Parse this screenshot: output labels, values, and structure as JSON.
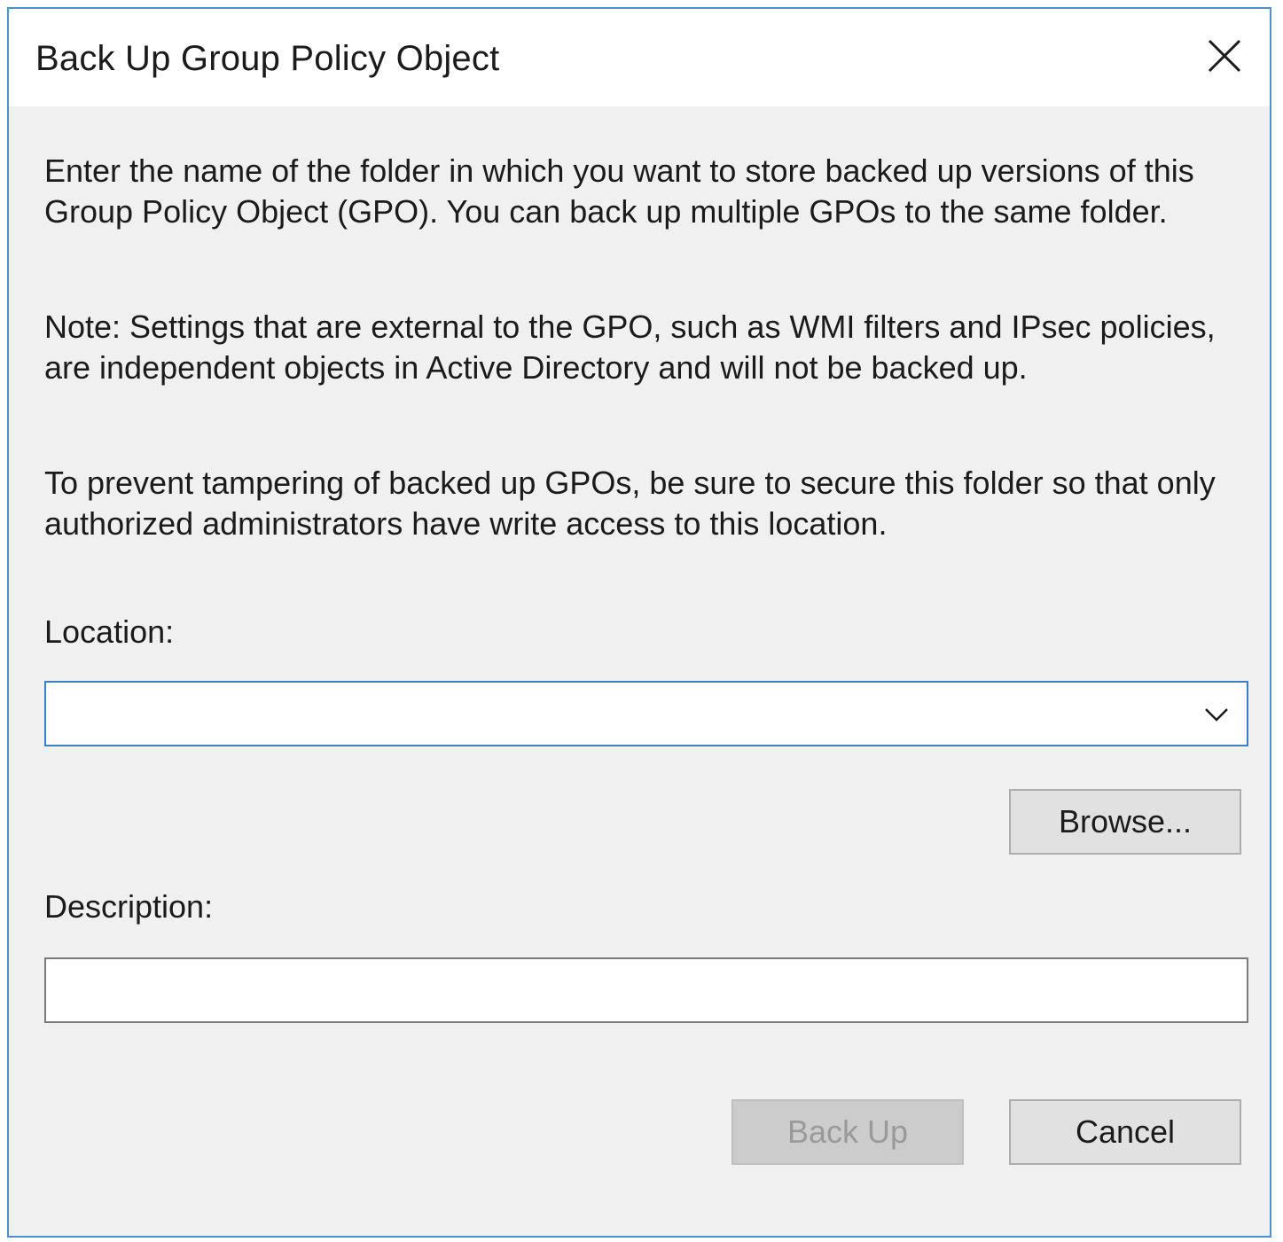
{
  "dialog": {
    "title": "Back Up Group Policy Object",
    "close_icon": "close-icon",
    "accent_color": "#4f8fd0"
  },
  "content": {
    "paragraph1": "Enter the name of the folder in which you want to store backed up versions of this Group Policy Object (GPO). You can back up multiple GPOs to the same folder.",
    "paragraph2": "Note: Settings that are external to the GPO, such as WMI filters and IPsec policies, are independent objects in Active Directory and will not be backed up.",
    "paragraph3": "To prevent tampering of backed up GPOs, be sure to secure this folder so that only authorized administrators have write access to this location."
  },
  "location": {
    "label": "Location:",
    "value": "",
    "dropdown_icon": "chevron-down-icon"
  },
  "browse_label": "Browse...",
  "description": {
    "label": "Description:",
    "value": ""
  },
  "buttons": {
    "backup_label": "Back Up",
    "backup_enabled": false,
    "cancel_label": "Cancel"
  }
}
